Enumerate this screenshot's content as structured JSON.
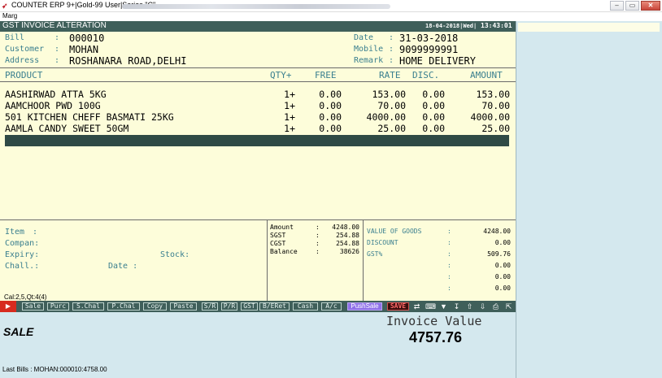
{
  "window": {
    "title": "COUNTER ERP 9+|Gold-99 User|Series \"C\"",
    "menu": "Marg",
    "controls": [
      "–",
      "▭",
      "✕"
    ]
  },
  "screen": {
    "title": "GST INVOICE ALTERATION",
    "date": "18-04-2018|Wed|",
    "time": "13:43:01"
  },
  "header": {
    "bill_label": "Bill",
    "bill": "000010",
    "customer_label": "Customer",
    "customer": "MOHAN",
    "address_label": "Address",
    "address": "ROSHANARA ROAD,DELHI",
    "date_label": "Date",
    "date": "31-03-2018",
    "mobile_label": "Mobile",
    "mobile": "9099999991",
    "remark_label": "Remark",
    "remark": "HOME DELIVERY",
    "colon": ":"
  },
  "columns": {
    "product": "PRODUCT",
    "qty": "QTY+",
    "free": "FREE",
    "rate": "RATE",
    "disc": "DISC.",
    "amount": "AMOUNT"
  },
  "items": [
    {
      "product": "AASHIRWAD ATTA 5KG",
      "qty": "1+",
      "free": "0.00",
      "rate": "153.00",
      "disc": "0.00",
      "amount": "153.00"
    },
    {
      "product": "AAMCHOOR PWD 100G",
      "qty": "1+",
      "free": "0.00",
      "rate": "70.00",
      "disc": "0.00",
      "amount": "70.00"
    },
    {
      "product": "501 KITCHEN CHEFF BASMATI 25KG",
      "qty": "1+",
      "free": "0.00",
      "rate": "4000.00",
      "disc": "0.00",
      "amount": "4000.00"
    },
    {
      "product": "AAMLA CANDY SWEET 50GM",
      "qty": "1+",
      "free": "0.00",
      "rate": "25.00",
      "disc": "0.00",
      "amount": "25.00"
    }
  ],
  "detail": {
    "item_label": "Item",
    "company_label": "Compan:",
    "expiry_label": "Expiry:",
    "challan_label": "Chall.:",
    "date_label": "Date :",
    "stock_label": "Stock:",
    "calc": "Cal:2,5,Qt:4(4)"
  },
  "totals": [
    {
      "label": "Amount",
      "value": "4248.00"
    },
    {
      "label": "SGST",
      "value": "254.88"
    },
    {
      "label": "CGST",
      "value": "254.88"
    },
    {
      "label": "Balance",
      "value": "38626"
    }
  ],
  "summary": [
    {
      "label": "VALUE OF GOODS",
      "value": "4248.00"
    },
    {
      "label": "DISCOUNT",
      "value": "0.00"
    },
    {
      "label": "GST%",
      "value": "509.76"
    },
    {
      "label": "",
      "value": "0.00"
    },
    {
      "label": "",
      "value": "0.00"
    },
    {
      "label": "",
      "value": "0.00"
    }
  ],
  "toolbar": {
    "buttons": [
      "Sale",
      "Purc",
      "S.Chal",
      "P.Chal",
      "Copy",
      "Paste",
      "S/R",
      "P/R",
      "GST",
      "B/ERet",
      "Cash",
      "A/c"
    ],
    "push_sale": "PushSale",
    "save": "SAVE",
    "icons": [
      "shuffle-icon",
      "keyboard-icon",
      "arrow-down-icon",
      "arrow-down-end-icon",
      "arrow-up-icon",
      "arrow-down-small-icon",
      "print-icon",
      "exit-icon"
    ]
  },
  "footer": {
    "mode": "SALE",
    "invoice_label": "Invoice Value",
    "invoice_value": "4757.76",
    "last_bills": "Last Bills : MOHAN:000010:4758.00"
  },
  "colors": {
    "header_bar": "#3f5f5a",
    "main_bg": "#fdfdda",
    "label_teal": "#3a7f8f",
    "panel_bg": "#d4e8ee",
    "save_text": "#ff6a6a",
    "push_sale_bg": "#8f70e8"
  }
}
